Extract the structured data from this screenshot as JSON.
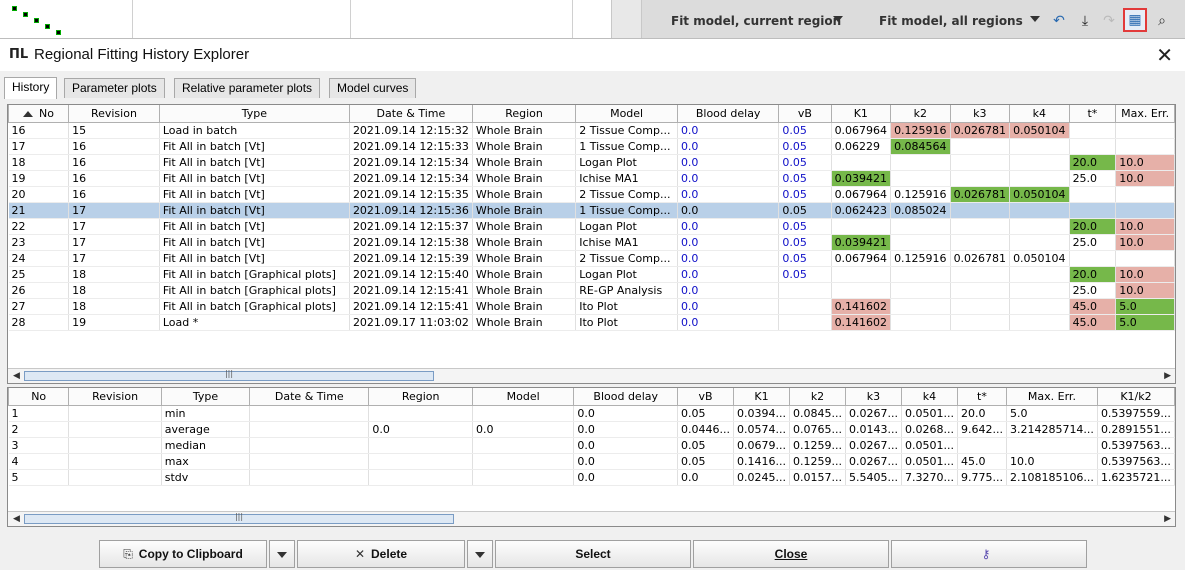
{
  "app_toolbar": {
    "fit_current_label": "Fit model, current region",
    "fit_all_label": "Fit model, all regions",
    "icons": [
      "undo-icon",
      "download-icon",
      "redo-icon",
      "history-explorer-icon",
      "preview-icon"
    ]
  },
  "dialog": {
    "logo": "ПL",
    "title": "Regional Fitting History Explorer",
    "close": "✕"
  },
  "tabs": [
    "History",
    "Parameter plots",
    "Relative parameter plots",
    "Model curves"
  ],
  "history_table": {
    "columns": [
      "No",
      "Revision",
      "Type",
      "Date & Time",
      "Region",
      "Model",
      "Blood delay",
      "vB",
      "K1",
      "k2",
      "k3",
      "k4",
      "t*",
      "Max. Err."
    ],
    "rows": [
      {
        "no": "16",
        "rev": "15",
        "type": "Load in batch",
        "dt": "2021.09.14 12:15:32",
        "region": "Whole Brain",
        "model": "2 Tissue Comp...",
        "bd": "0.0",
        "vb": "0.05",
        "K1": "0.067964",
        "k2": "0.125916",
        "k3": "0.026781",
        "k4": "0.050104",
        "ts": "",
        "me": "",
        "sel": false,
        "hl": {
          "k2": "r",
          "k3": "r",
          "k4": "r"
        }
      },
      {
        "no": "17",
        "rev": "16",
        "type": "Fit All in batch [Vt]",
        "dt": "2021.09.14 12:15:33",
        "region": "Whole Brain",
        "model": "1 Tissue Comp...",
        "bd": "0.0",
        "vb": "0.05",
        "K1": "0.06229",
        "k2": "0.084564",
        "k3": "",
        "k4": "",
        "ts": "",
        "me": "",
        "sel": false,
        "hl": {
          "k2": "g"
        }
      },
      {
        "no": "18",
        "rev": "16",
        "type": "Fit All in batch [Vt]",
        "dt": "2021.09.14 12:15:34",
        "region": "Whole Brain",
        "model": "Logan Plot",
        "bd": "0.0",
        "vb": "0.05",
        "K1": "",
        "k2": "",
        "k3": "",
        "k4": "",
        "ts": "20.0",
        "me": "10.0",
        "sel": false,
        "hl": {
          "ts": "g",
          "me": "r"
        }
      },
      {
        "no": "19",
        "rev": "16",
        "type": "Fit All in batch [Vt]",
        "dt": "2021.09.14 12:15:34",
        "region": "Whole Brain",
        "model": "Ichise MA1",
        "bd": "0.0",
        "vb": "0.05",
        "K1": "0.039421",
        "k2": "",
        "k3": "",
        "k4": "",
        "ts": "25.0",
        "me": "10.0",
        "sel": false,
        "hl": {
          "K1": "g",
          "me": "r"
        }
      },
      {
        "no": "20",
        "rev": "16",
        "type": "Fit All in batch [Vt]",
        "dt": "2021.09.14 12:15:35",
        "region": "Whole Brain",
        "model": "2 Tissue Comp...",
        "bd": "0.0",
        "vb": "0.05",
        "K1": "0.067964",
        "k2": "0.125916",
        "k3": "0.026781",
        "k4": "0.050104",
        "ts": "",
        "me": "",
        "sel": false,
        "hl": {
          "k3": "g",
          "k4": "g"
        }
      },
      {
        "no": "21",
        "rev": "17",
        "type": "Fit All in batch [Vt]",
        "dt": "2021.09.14 12:15:36",
        "region": "Whole Brain",
        "model": "1 Tissue Comp...",
        "bd": "0.0",
        "vb": "0.05",
        "K1": "0.062423",
        "k2": "0.085024",
        "k3": "",
        "k4": "",
        "ts": "",
        "me": "",
        "sel": true,
        "hl": {}
      },
      {
        "no": "22",
        "rev": "17",
        "type": "Fit All in batch [Vt]",
        "dt": "2021.09.14 12:15:37",
        "region": "Whole Brain",
        "model": "Logan Plot",
        "bd": "0.0",
        "vb": "0.05",
        "K1": "",
        "k2": "",
        "k3": "",
        "k4": "",
        "ts": "20.0",
        "me": "10.0",
        "sel": false,
        "hl": {
          "ts": "g",
          "me": "r"
        }
      },
      {
        "no": "23",
        "rev": "17",
        "type": "Fit All in batch [Vt]",
        "dt": "2021.09.14 12:15:38",
        "region": "Whole Brain",
        "model": "Ichise MA1",
        "bd": "0.0",
        "vb": "0.05",
        "K1": "0.039421",
        "k2": "",
        "k3": "",
        "k4": "",
        "ts": "25.0",
        "me": "10.0",
        "sel": false,
        "hl": {
          "K1": "g",
          "me": "r"
        }
      },
      {
        "no": "24",
        "rev": "17",
        "type": "Fit All in batch [Vt]",
        "dt": "2021.09.14 12:15:39",
        "region": "Whole Brain",
        "model": "2 Tissue Comp...",
        "bd": "0.0",
        "vb": "0.05",
        "K1": "0.067964",
        "k2": "0.125916",
        "k3": "0.026781",
        "k4": "0.050104",
        "ts": "",
        "me": "",
        "sel": false,
        "hl": {}
      },
      {
        "no": "25",
        "rev": "18",
        "type": "Fit All in batch [Graphical plots]",
        "dt": "2021.09.14 12:15:40",
        "region": "Whole Brain",
        "model": "Logan Plot",
        "bd": "0.0",
        "vb": "0.05",
        "K1": "",
        "k2": "",
        "k3": "",
        "k4": "",
        "ts": "20.0",
        "me": "10.0",
        "sel": false,
        "hl": {
          "ts": "g",
          "me": "r"
        }
      },
      {
        "no": "26",
        "rev": "18",
        "type": "Fit All in batch [Graphical plots]",
        "dt": "2021.09.14 12:15:41",
        "region": "Whole Brain",
        "model": "RE-GP Analysis",
        "bd": "0.0",
        "vb": "",
        "K1": "",
        "k2": "",
        "k3": "",
        "k4": "",
        "ts": "25.0",
        "me": "10.0",
        "sel": false,
        "hl": {
          "me": "r"
        }
      },
      {
        "no": "27",
        "rev": "18",
        "type": "Fit All in batch [Graphical plots]",
        "dt": "2021.09.14 12:15:41",
        "region": "Whole Brain",
        "model": "Ito Plot",
        "bd": "0.0",
        "vb": "",
        "K1": "0.141602",
        "k2": "",
        "k3": "",
        "k4": "",
        "ts": "45.0",
        "me": "5.0",
        "sel": false,
        "hl": {
          "K1": "r",
          "ts": "r",
          "me": "g"
        }
      },
      {
        "no": "28",
        "rev": "19",
        "type": "Load *",
        "dt": "2021.09.17 11:03:02",
        "region": "Whole Brain",
        "model": "Ito Plot",
        "bd": "0.0",
        "vb": "",
        "K1": "0.141602",
        "k2": "",
        "k3": "",
        "k4": "",
        "ts": "45.0",
        "me": "5.0",
        "sel": false,
        "hl": {
          "K1": "r",
          "ts": "r",
          "me": "g"
        }
      }
    ]
  },
  "stats_table": {
    "columns": [
      "No",
      "Revision",
      "Type",
      "Date & Time",
      "Region",
      "Model",
      "Blood delay",
      "vB",
      "K1",
      "k2",
      "k3",
      "k4",
      "t*",
      "Max. Err.",
      "K1/k2"
    ],
    "rows": [
      [
        "1",
        "",
        "min",
        "",
        "",
        "",
        "0.0",
        "0.05",
        "0.0394...",
        "0.0845...",
        "0.0267...",
        "0.0501...",
        "20.0",
        "5.0",
        "0.5397559..."
      ],
      [
        "2",
        "",
        "average",
        "",
        "0.0",
        "0.0",
        "0.0",
        "0.0446...",
        "0.0574...",
        "0.0765...",
        "0.0143...",
        "0.0268...",
        "9.642...",
        "3.214285714...",
        "0.2891551..."
      ],
      [
        "3",
        "",
        "median",
        "",
        "",
        "",
        "0.0",
        "0.05",
        "0.0679...",
        "0.1259...",
        "0.0267...",
        "0.0501...",
        "",
        "",
        "0.5397563..."
      ],
      [
        "4",
        "",
        "max",
        "",
        "",
        "",
        "0.0",
        "0.05",
        "0.1416...",
        "0.1259...",
        "0.0267...",
        "0.0501...",
        "45.0",
        "10.0",
        "0.5397563..."
      ],
      [
        "5",
        "",
        "stdv",
        "",
        "",
        "",
        "0.0",
        "0.0",
        "0.0245...",
        "0.0157...",
        "5.5405...",
        "7.3270...",
        "9.775...",
        "2.108185106...",
        "1.6235721..."
      ]
    ]
  },
  "buttons": {
    "copy": "Copy to Clipboard",
    "delete": "Delete",
    "select": "Select",
    "close": "Close"
  },
  "colors": {
    "highlight_green": "#76b84a",
    "highlight_red": "#e6b0a8",
    "selected_row": "#b9d0e8",
    "link_blue": "#1010c8"
  }
}
